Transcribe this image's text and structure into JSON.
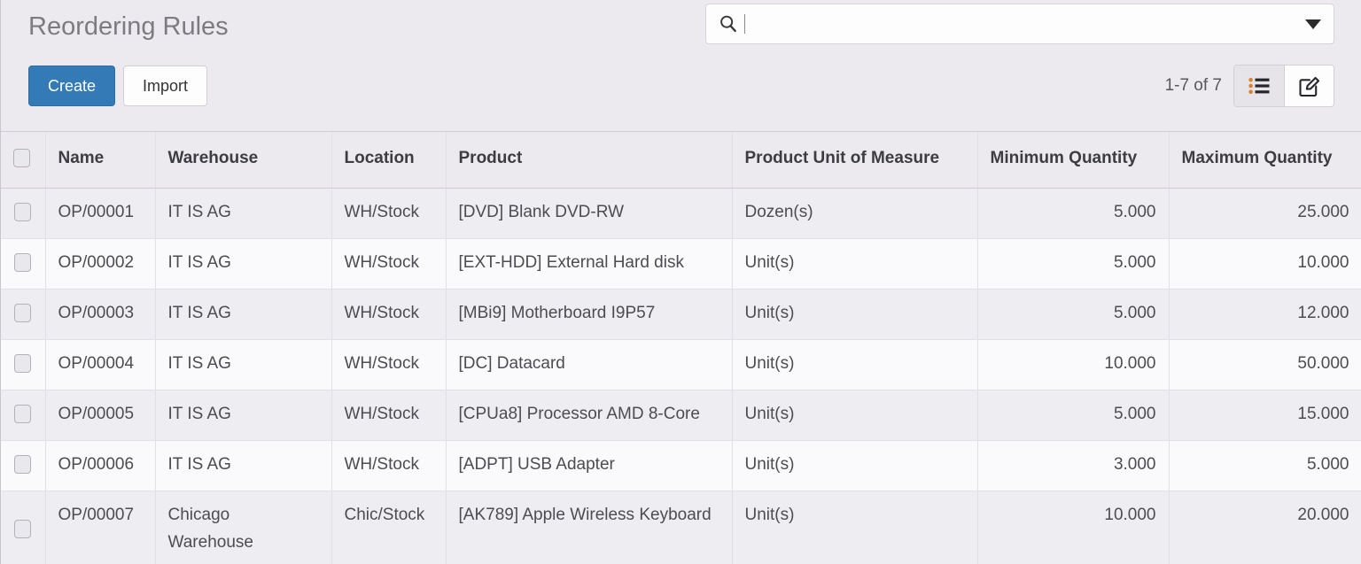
{
  "header": {
    "title": "Reordering Rules"
  },
  "toolbar": {
    "create_label": "Create",
    "import_label": "Import",
    "pager_text": "1-7 of 7",
    "view_list_name": "list-view-icon",
    "view_form_name": "form-view-icon"
  },
  "search": {
    "value": "",
    "placeholder": "",
    "icon": "search-icon",
    "toggle_icon": "chevron-down-icon"
  },
  "table": {
    "columns": [
      {
        "key": "name",
        "label": "Name",
        "align": "left"
      },
      {
        "key": "wh",
        "label": "Warehouse",
        "align": "left"
      },
      {
        "key": "loc",
        "label": "Location",
        "align": "left"
      },
      {
        "key": "prod",
        "label": "Product",
        "align": "left"
      },
      {
        "key": "uom",
        "label": "Product Unit of Measure",
        "align": "left"
      },
      {
        "key": "min",
        "label": "Minimum Quantity",
        "align": "right"
      },
      {
        "key": "max",
        "label": "Maximum Quantity",
        "align": "right"
      }
    ],
    "rows": [
      {
        "name": "OP/00001",
        "wh": "IT IS AG",
        "loc": "WH/Stock",
        "prod": "[DVD] Blank DVD-RW",
        "uom": "Dozen(s)",
        "min": "5.000",
        "max": "25.000"
      },
      {
        "name": "OP/00002",
        "wh": "IT IS AG",
        "loc": "WH/Stock",
        "prod": "[EXT-HDD] External Hard disk",
        "uom": "Unit(s)",
        "min": "5.000",
        "max": "10.000"
      },
      {
        "name": "OP/00003",
        "wh": "IT IS AG",
        "loc": "WH/Stock",
        "prod": "[MBi9] Motherboard I9P57",
        "uom": "Unit(s)",
        "min": "5.000",
        "max": "12.000"
      },
      {
        "name": "OP/00004",
        "wh": "IT IS AG",
        "loc": "WH/Stock",
        "prod": "[DC] Datacard",
        "uom": "Unit(s)",
        "min": "10.000",
        "max": "50.000"
      },
      {
        "name": "OP/00005",
        "wh": "IT IS AG",
        "loc": "WH/Stock",
        "prod": "[CPUa8] Processor AMD 8-Core",
        "uom": "Unit(s)",
        "min": "5.000",
        "max": "15.000"
      },
      {
        "name": "OP/00006",
        "wh": "IT IS AG",
        "loc": "WH/Stock",
        "prod": "[ADPT] USB Adapter",
        "uom": "Unit(s)",
        "min": "3.000",
        "max": "5.000"
      },
      {
        "name": "OP/00007",
        "wh": "Chicago Warehouse",
        "loc": "Chic/Stock",
        "prod": "[AK789] Apple Wireless Keyboard",
        "uom": "Unit(s)",
        "min": "10.000",
        "max": "20.000"
      }
    ]
  },
  "colors": {
    "primary": "#337AB7",
    "toolbar_bg": "#ECEAEF",
    "row_odd": "#EDEDF2",
    "row_even": "#FAFAFC"
  }
}
